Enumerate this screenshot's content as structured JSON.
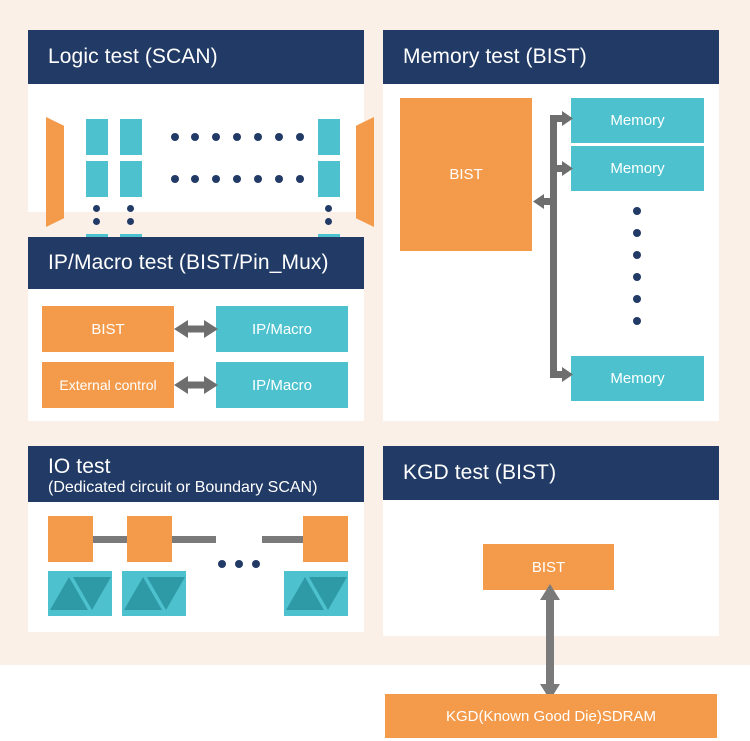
{
  "page": {
    "background": "#faf0e7",
    "panel_background": "#ffffff",
    "header_color": "#223B66",
    "orange": "#F49B4B",
    "teal": "#4DC2CE",
    "teal_dark": "#2E9AA6",
    "connector_gray": "#7a7a7a"
  },
  "panels": {
    "logic": {
      "title": "Logic test (SCAN)",
      "subtitle": ""
    },
    "ipmacro": {
      "title": "IP/Macro test (BIST/Pin_Mux)",
      "subtitle": "",
      "blocks": {
        "bist": "BIST",
        "external_control": "External control",
        "ip_macro_top": "IP/Macro",
        "ip_macro_bottom": "IP/Macro"
      }
    },
    "io": {
      "title": "IO test",
      "subtitle": "(Dedicated circuit or Boundary SCAN)"
    },
    "memory": {
      "title": "Memory test (BIST)",
      "subtitle": "",
      "blocks": {
        "bist": "BIST",
        "memory_1": "Memory",
        "memory_2": "Memory",
        "memory_n": "Memory"
      }
    },
    "kgd": {
      "title": "KGD test (BIST)",
      "subtitle": "",
      "blocks": {
        "bist": "BIST",
        "sdram": "KGD(Known Good Die)SDRAM"
      }
    }
  }
}
